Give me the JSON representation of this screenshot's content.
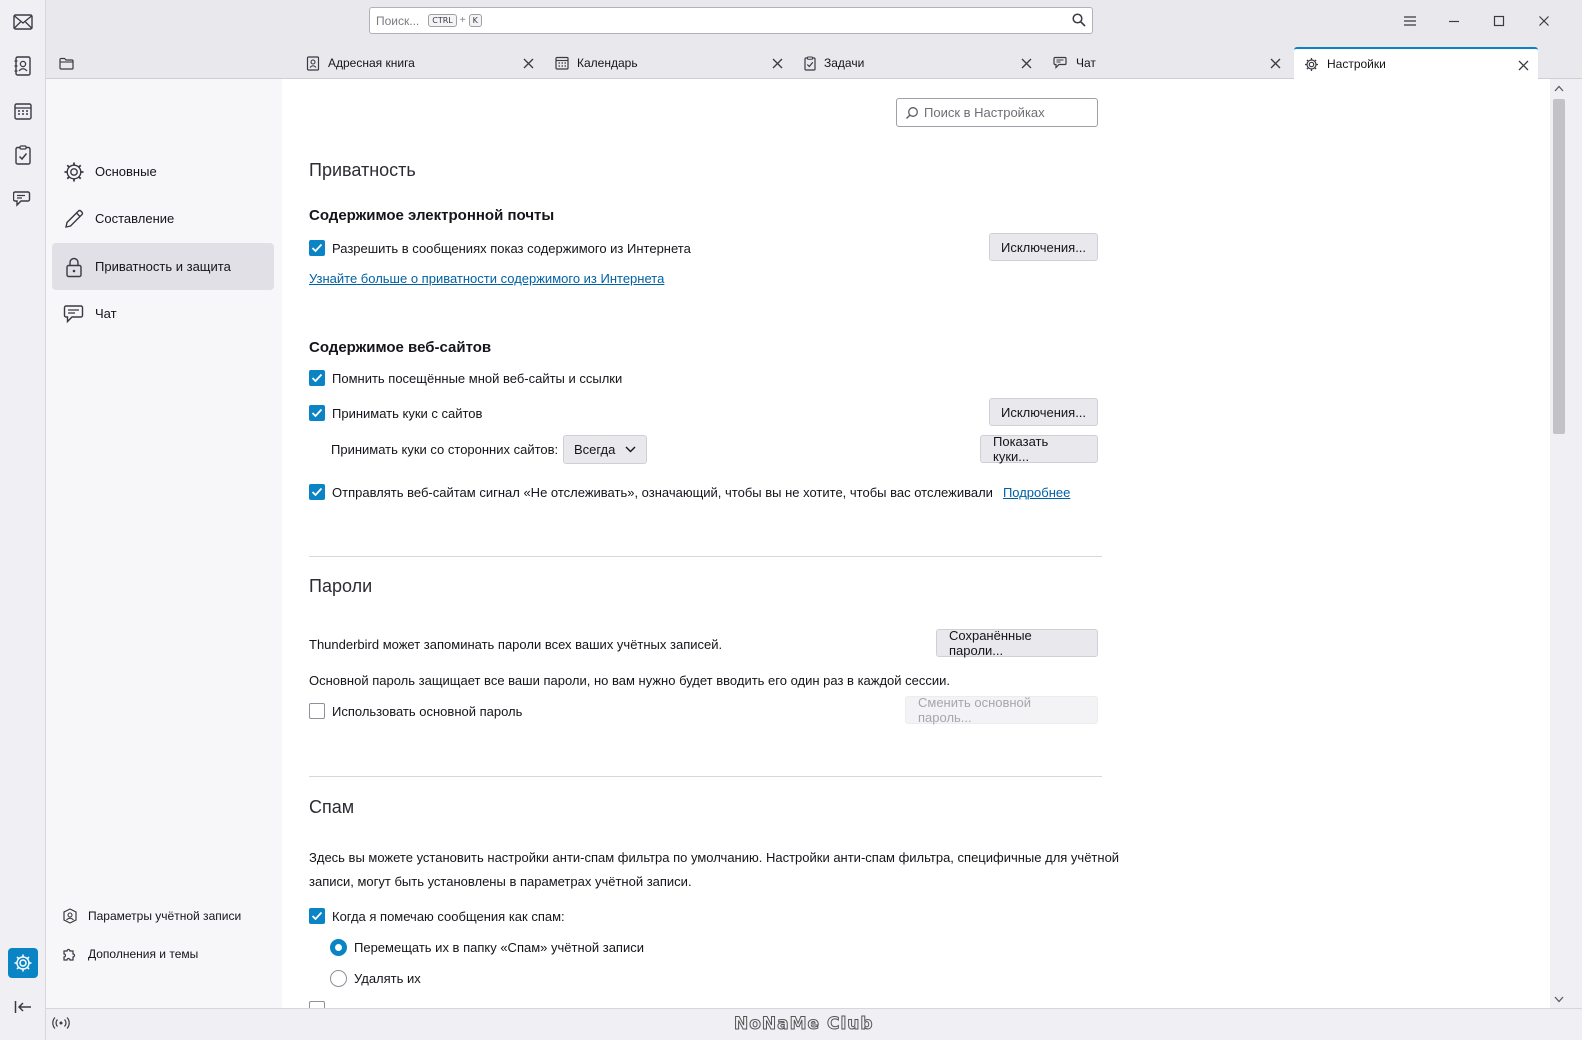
{
  "search": {
    "placeholder": "Поиск...",
    "kbd1": "CTRL",
    "plus": "+",
    "kbd2": "K"
  },
  "tabs": [
    {
      "label": "Адресная книга",
      "icon": "address-book-icon"
    },
    {
      "label": "Календарь",
      "icon": "calendar-icon"
    },
    {
      "label": "Задачи",
      "icon": "tasks-icon"
    },
    {
      "label": "Чат",
      "icon": "chat-icon"
    },
    {
      "label": "Настройки",
      "icon": "gear-icon",
      "active": true
    }
  ],
  "sidebar": {
    "categories": [
      {
        "label": "Основные",
        "icon": "gear-icon"
      },
      {
        "label": "Составление",
        "icon": "pencil-icon"
      },
      {
        "label": "Приватность и защита",
        "icon": "lock-icon",
        "selected": true
      },
      {
        "label": "Чат",
        "icon": "chat-icon"
      }
    ],
    "footer": [
      {
        "label": "Параметры учётной записи",
        "icon": "account-icon"
      },
      {
        "label": "Дополнения и темы",
        "icon": "puzzle-icon"
      }
    ]
  },
  "pane": {
    "search_placeholder": "Поиск в Настройках",
    "privacy": {
      "title": "Приватность",
      "mail_content_heading": "Содержимое электронной почты",
      "allow_remote_label": "Разрешить в сообщениях показ содержимого из Интернета",
      "allow_remote_checked": true,
      "exceptions_label": "Исключения...",
      "learn_more_link": "Узнайте больше о приватности содержимого из Интернета",
      "web_content_heading": "Содержимое веб-сайтов",
      "remember_history_label": "Помнить посещённые мной веб-сайты и ссылки",
      "remember_history_checked": true,
      "accept_cookies_label": "Принимать куки с сайтов",
      "accept_cookies_checked": true,
      "cookie_exceptions_label": "Исключения...",
      "third_party_label": "Принимать куки со сторонних сайтов:",
      "third_party_value": "Всегда",
      "show_cookies_label": "Показать куки...",
      "dnt_label": "Отправлять веб-сайтам сигнал «Не отслеживать», означающий, чтобы вы не хотите, чтобы вас отслеживали",
      "dnt_checked": true,
      "dnt_link": "Подробнее"
    },
    "passwords": {
      "title": "Пароли",
      "intro": "Thunderbird может запоминать пароли всех ваших учётных записей.",
      "saved_button": "Сохранённые пароли...",
      "primary_desc": "Основной пароль защищает все ваши пароли, но вам нужно будет вводить его один раз в каждой сессии.",
      "use_primary_label": "Использовать основной пароль",
      "use_primary_checked": false,
      "change_primary_button": "Сменить основной пароль..."
    },
    "spam": {
      "title": "Спам",
      "desc_line1": "Здесь вы можете установить настройки анти-спам фильтра по умолчанию. Настройки анти-спам фильтра, специфичные для учётной",
      "desc_line2": "записи, могут быть установлены в параметрах учётной записи.",
      "mark_label": "Когда я помечаю сообщения как спам:",
      "mark_checked": true,
      "move_label": "Перемещать их в папку «Спам» учётной записи",
      "move_selected": true,
      "delete_label": "Удалять их",
      "delete_selected": false
    }
  },
  "statusbar": {
    "watermark": "NoNaMe Club"
  },
  "colors": {
    "accent": "#0a84c4",
    "link": "#0061a4"
  }
}
